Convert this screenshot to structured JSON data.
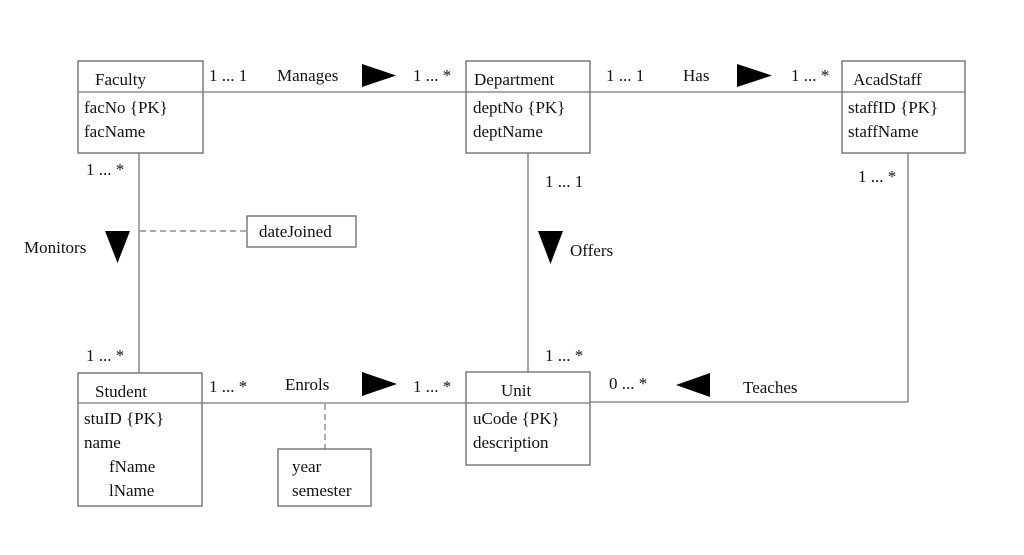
{
  "entities": {
    "faculty": {
      "name": "Faculty",
      "attributes": [
        "facNo {PK}",
        "facName"
      ]
    },
    "department": {
      "name": "Department",
      "attributes": [
        "deptNo {PK}",
        "deptName"
      ]
    },
    "acadstaff": {
      "name": "AcadStaff",
      "attributes": [
        "staffID {PK}",
        "staffName"
      ]
    },
    "student": {
      "name": "Student",
      "attributes": [
        "stuID {PK}",
        "name",
        "fName",
        "lName"
      ]
    },
    "unit": {
      "name": "Unit",
      "attributes": [
        "uCode {PK}",
        "description"
      ]
    }
  },
  "relationships": {
    "manages": {
      "label": "Manages",
      "direction": "right",
      "from": "Faculty",
      "to": "Department",
      "from_multiplicity": "1 ... 1",
      "to_multiplicity": "1 ... *"
    },
    "has": {
      "label": "Has",
      "direction": "right",
      "from": "Department",
      "to": "AcadStaff",
      "from_multiplicity": "1 ... 1",
      "to_multiplicity": "1 ... *"
    },
    "monitors": {
      "label": "Monitors",
      "direction": "down",
      "from": "Faculty",
      "to": "Student",
      "from_multiplicity": "1 ... *",
      "to_multiplicity": "1 ... *"
    },
    "offers": {
      "label": "Offers",
      "direction": "down",
      "from": "Department",
      "to": "Unit",
      "from_multiplicity": "1 ... 1",
      "to_multiplicity": "1 ... *"
    },
    "enrols": {
      "label": "Enrols",
      "direction": "right",
      "from": "Student",
      "to": "Unit",
      "from_multiplicity": "1 ... *",
      "to_multiplicity": "1 ... *"
    },
    "teaches": {
      "label": "Teaches",
      "direction": "left",
      "from": "AcadStaff",
      "to": "Unit",
      "from_multiplicity": "1 ... *",
      "to_multiplicity": "0 ... *"
    }
  },
  "association_attributes": {
    "monitors": [
      "dateJoined"
    ],
    "enrols": [
      "year",
      "semester"
    ]
  }
}
